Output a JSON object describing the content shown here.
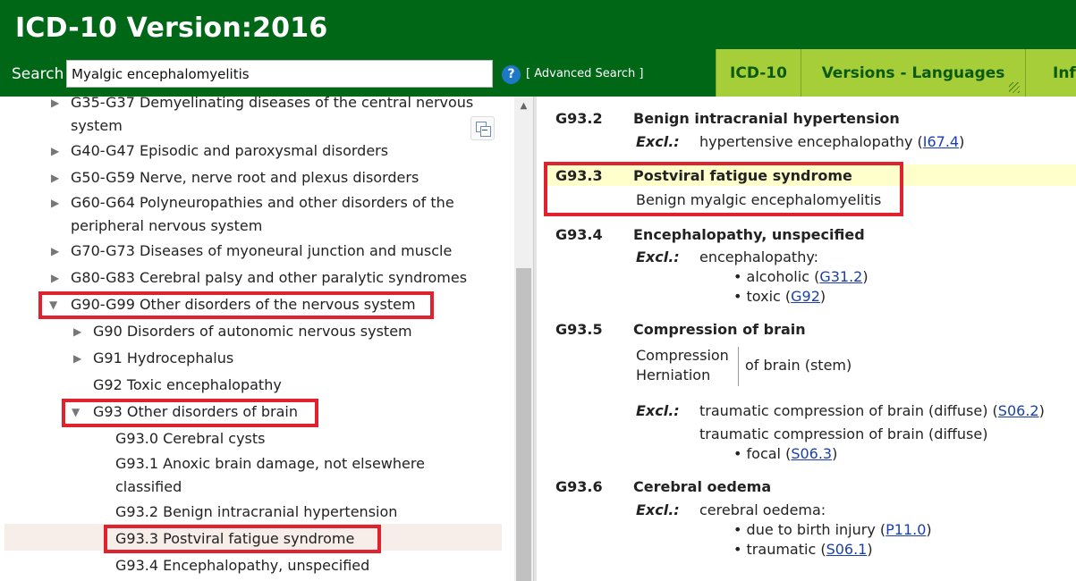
{
  "header": {
    "title": "ICD-10 Version:2016",
    "search_label": "Search",
    "search_value": "Myalgic encephalomyelitis",
    "help_label": "?",
    "advanced_search": "[ Advanced Search ]",
    "tabs": [
      "ICD-10",
      "Versions - Languages",
      "Info"
    ]
  },
  "tree": {
    "items": [
      {
        "line1": "G35-G37 Demyelinating diseases of the central nervous",
        "line2": "system",
        "arrow": "▶"
      },
      {
        "line1": "G40-G47 Episodic and paroxysmal disorders",
        "arrow": "▶"
      },
      {
        "line1": "G50-G59 Nerve, nerve root and plexus disorders",
        "arrow": "▶"
      },
      {
        "line1": "G60-G64 Polyneuropathies and other disorders of the",
        "line2": "peripheral nervous system",
        "arrow": "▶"
      },
      {
        "line1": "G70-G73 Diseases of myoneural junction and muscle",
        "arrow": "▶"
      },
      {
        "line1": "G80-G83 Cerebral palsy and other paralytic syndromes",
        "arrow": "▶"
      },
      {
        "line1": "G90-G99 Other disorders of the nervous system",
        "arrow": "▼"
      },
      {
        "line1": "G90 Disorders of autonomic nervous system",
        "arrow": "▶"
      },
      {
        "line1": "G91 Hydrocephalus",
        "arrow": "▶"
      },
      {
        "line1": "G92 Toxic encephalopathy"
      },
      {
        "line1": "G93 Other disorders of brain",
        "arrow": "▼"
      },
      {
        "line1": "G93.0 Cerebral cysts"
      },
      {
        "line1": "G93.1 Anoxic brain damage, not elsewhere",
        "line2": "classified"
      },
      {
        "line1": "G93.2 Benign intracranial hypertension"
      },
      {
        "line1": "G93.3 Postviral fatigue syndrome"
      },
      {
        "line1": "G93.4 Encephalopathy, unspecified"
      }
    ]
  },
  "content": {
    "excl_label": "Excl.:",
    "g932": {
      "code": "G93.2",
      "title": "Benign intracranial hypertension",
      "excl_text": "hypertensive encephalopathy (",
      "excl_link": "I67.4",
      "excl_close": ")"
    },
    "g933": {
      "code": "G93.3",
      "title": "Postviral fatigue syndrome",
      "incl": "Benign myalgic encephalomyelitis"
    },
    "g934": {
      "code": "G93.4",
      "title": "Encephalopathy, unspecified",
      "excl_text": "encephalopathy:",
      "b1_text": "alcoholic (",
      "b1_link": "G31.2",
      "b2_text": "toxic (",
      "b2_link": "G92",
      "close": ")"
    },
    "g935": {
      "code": "G93.5",
      "title": "Compression of brain",
      "left1": "Compression",
      "left2": "Herniation",
      "right": "of brain (stem)",
      "excl1_text": "traumatic compression of brain (diffuse) (",
      "excl1_link": "S06.2",
      "excl2_text": "traumatic compression of brain (diffuse)",
      "b1_text": "focal (",
      "b1_link": "S06.3",
      "close": ")"
    },
    "g936": {
      "code": "G93.6",
      "title": "Cerebral oedema",
      "excl_text": "cerebral oedema:",
      "b1_text": "due to birth injury (",
      "b1_link": "P11.0",
      "b2_text": "traumatic (",
      "b2_link": "S06.1",
      "close": ")"
    }
  },
  "colors": {
    "header_bg": "#006717",
    "tab_bg": "#a6ce39",
    "annotation_red": "#e0212e",
    "highlight_yellow": "#ffffcc",
    "link_blue": "#1a3faa"
  }
}
